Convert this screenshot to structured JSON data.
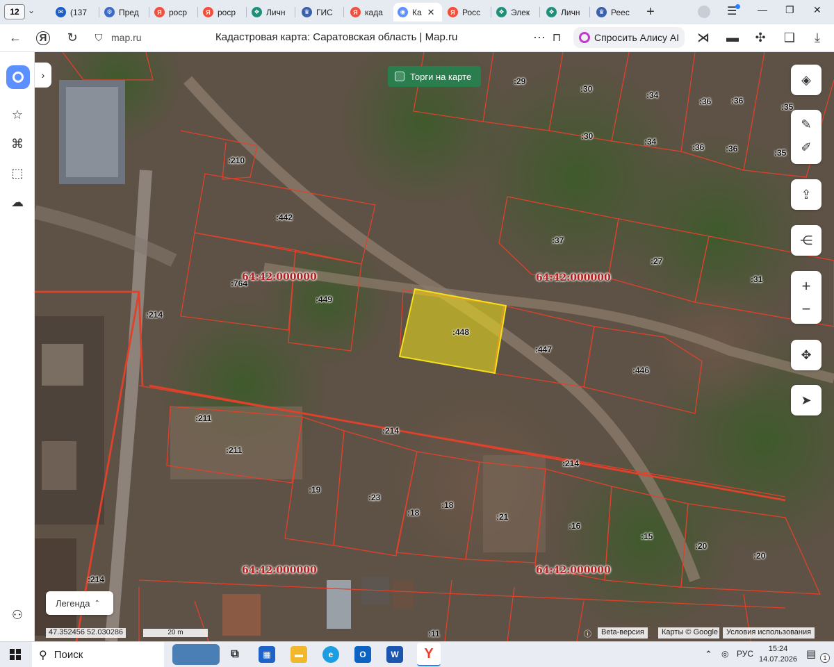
{
  "tabs": {
    "count": "12",
    "items": [
      {
        "label": "(137",
        "icon": "mail-icon",
        "color": "#1a5ec9"
      },
      {
        "label": "Пред",
        "icon": "gear-icon",
        "color": "#3d6ac4"
      },
      {
        "label": "роср",
        "icon": "yandex-icon",
        "color": "#f04f3c"
      },
      {
        "label": "роср",
        "icon": "yandex-icon",
        "color": "#f04f3c"
      },
      {
        "label": "Личн",
        "icon": "gosuslugi-icon",
        "color": "#1f8f7a"
      },
      {
        "label": "ГИС",
        "icon": "eagle-icon",
        "color": "#3b5fa8"
      },
      {
        "label": "када",
        "icon": "yandex-icon",
        "color": "#f04f3c"
      },
      {
        "label": "Ка",
        "icon": "maps-icon",
        "color": "#5c8fff",
        "active": true
      },
      {
        "label": "Росс",
        "icon": "yandex-icon",
        "color": "#f04f3c"
      },
      {
        "label": "Элек",
        "icon": "gosuslugi-icon",
        "color": "#1f8f7a"
      },
      {
        "label": "Личн",
        "icon": "gosuslugi-icon",
        "color": "#1f8f7a"
      },
      {
        "label": "Реес",
        "icon": "eagle-icon",
        "color": "#3b5fa8"
      }
    ]
  },
  "address": {
    "domain": "map.ru",
    "title": "Кадастровая карта: Саратовская область | Map.ru",
    "alice_label": "Спросить Алису AI"
  },
  "map": {
    "torgi_label": "Торги на карте",
    "quarter_label": "64:42:000000",
    "parcels": [
      ":29",
      ":30",
      ":30",
      ":34",
      ":34",
      ":36",
      ":36",
      ":36",
      ":36",
      ":35",
      ":35",
      ":210",
      ":442",
      ":764",
      ":449",
      ":448",
      ":447",
      ":446",
      ":37",
      ":27",
      ":31",
      ":214",
      ":214",
      ":214",
      ":214",
      ":211",
      ":211",
      ":19",
      ":23",
      ":18",
      ":18",
      ":21",
      ":16",
      ":15",
      ":20",
      ":20",
      ":11"
    ],
    "highlight_color": "#f2e21a",
    "boundary_color": "#e0412b"
  },
  "controls": {
    "legend_label": "Легенда",
    "coords": "47.352456  52.030286",
    "scale": "20 m",
    "beta": "Beta-версия",
    "copyright": "Карты © Google",
    "terms": "Условия использования"
  },
  "taskbar": {
    "search_label": "Поиск",
    "lang": "РУС",
    "time": "15:24",
    "date": "14.07.2026",
    "notif_count": "1"
  }
}
